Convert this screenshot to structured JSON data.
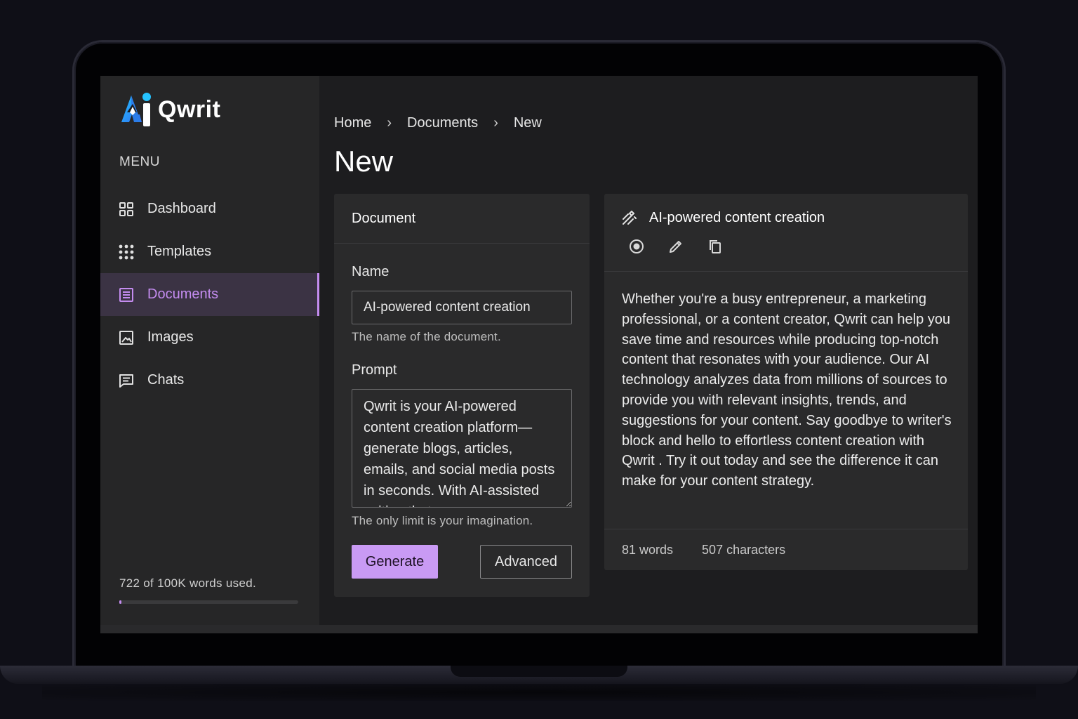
{
  "app": {
    "name": "Qwrit",
    "accent": "#c48cf0",
    "logo_colors": [
      "#1ea7ff",
      "#3b5bdb"
    ]
  },
  "sidebar": {
    "menu_label": "MENU",
    "items": [
      {
        "label": "Dashboard",
        "icon": "dashboard-grid-icon",
        "active": false
      },
      {
        "label": "Templates",
        "icon": "dots-grid-icon",
        "active": false
      },
      {
        "label": "Documents",
        "icon": "document-icon",
        "active": true
      },
      {
        "label": "Images",
        "icon": "image-icon",
        "active": false
      },
      {
        "label": "Chats",
        "icon": "chat-icon",
        "active": false
      }
    ],
    "usage": {
      "text": "722 of 100K words used.",
      "fraction": 0.00722
    }
  },
  "breadcrumb": [
    "Home",
    "Documents",
    "New"
  ],
  "page_title": "New",
  "document_card": {
    "title": "Document",
    "name_label": "Name",
    "name_value": "AI-powered content creation",
    "name_help": "The name of the document.",
    "prompt_label": "Prompt",
    "prompt_value": "Qwrit is your AI-powered content creation platform—generate blogs, articles, emails, and social media posts in seconds. With AI-assisted writing that",
    "prompt_help": "The only limit is your imagination.",
    "generate_label": "Generate",
    "advanced_label": "Advanced"
  },
  "output_card": {
    "title": "AI-powered content creation",
    "actions": [
      "stop-circle-icon",
      "pencil-icon",
      "copy-icon"
    ],
    "body": "Whether you're a busy entrepreneur, a marketing professional, or a content creator, Qwrit can help you save time and resources while producing top-notch content that resonates with your audience. Our AI technology analyzes data from millions of sources to provide you with relevant insights, trends, and suggestions for your content. Say goodbye to writer's block and hello to effortless content creation with Qwrit . Try it out today and see the difference it can make for your content strategy.",
    "words": "81 words",
    "characters": "507 characters"
  }
}
